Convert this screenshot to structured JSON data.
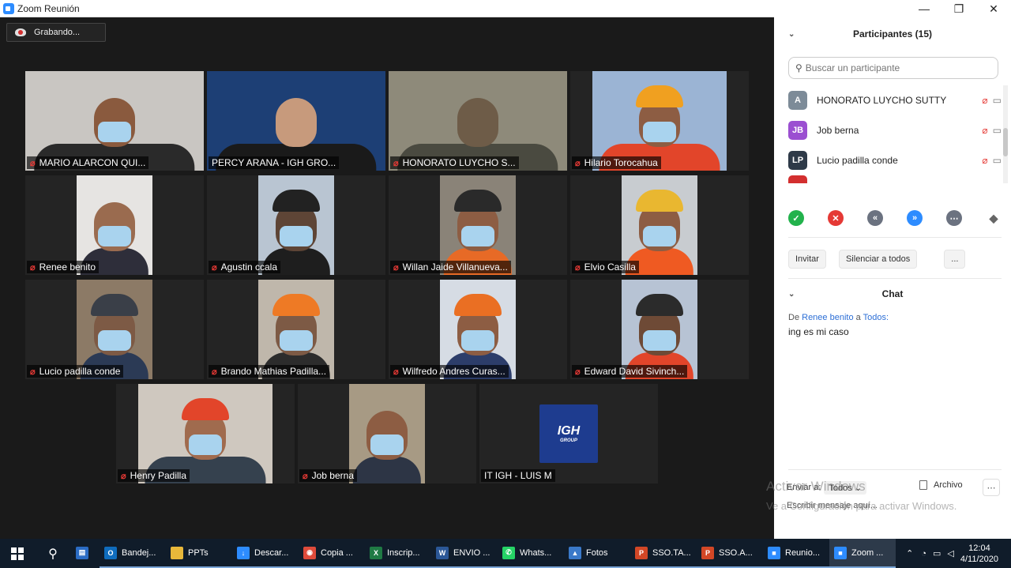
{
  "window": {
    "title": "Zoom Reunión",
    "controls": {
      "minimize": "—",
      "restore": "❐",
      "close": "✕"
    }
  },
  "recording": {
    "label": "Grabando..."
  },
  "tiles": [
    {
      "name": "MARIO ALARCON QUI...",
      "bg": "#c9c6c2",
      "skin": "#8a5a3e",
      "helmet": "",
      "body": "#2a2a2a",
      "muted": true
    },
    {
      "name": "PERCY ARANA - IGH GRO...",
      "bg": "#1d3f75",
      "skin": "#c79a7c",
      "helmet": "",
      "body": "#1a1a1a",
      "muted": false,
      "active": true
    },
    {
      "name": "HONORATO LUYCHO S...",
      "bg": "#8e8a7a",
      "skin": "#6e5c48",
      "helmet": "",
      "body": "#4a4a40",
      "muted": true
    },
    {
      "name": "Hilario Torocahua",
      "bg": "#9bb4d4",
      "skin": "#8d5d43",
      "helmet": "#f0a020",
      "body": "#e2452a",
      "muted": true
    },
    {
      "name": "Renee benito",
      "bg": "#e6e4e2",
      "skin": "#9a6b4f",
      "helmet": "",
      "body": "#2e2e3a",
      "muted": true
    },
    {
      "name": "Agustin ccala",
      "bg": "#b9c5d2",
      "skin": "#5e4536",
      "helmet": "#222222",
      "body": "#1e1e1e",
      "muted": true
    },
    {
      "name": "Willan Jaide Villanueva...",
      "bg": "#8a8378",
      "skin": "#8d5d43",
      "helmet": "#2a2a2a",
      "body": "#e76a26",
      "muted": true
    },
    {
      "name": "Elvio Casilla",
      "bg": "#c8ccd0",
      "skin": "#8d5d43",
      "helmet": "#e9b730",
      "body": "#ef5a22",
      "muted": true
    },
    {
      "name": "Lucio padilla conde",
      "bg": "#8c7a66",
      "skin": "#7d5a45",
      "helmet": "#3a3f48",
      "body": "#2b3a55",
      "muted": true
    },
    {
      "name": "Brando Mathias Padilla...",
      "bg": "#bfb7ab",
      "skin": "#7d5a45",
      "helmet": "#ee7a25",
      "body": "#2c2c2c",
      "muted": true
    },
    {
      "name": "Wilfredo Andres Curas...",
      "bg": "#d6dce4",
      "skin": "#8d5d43",
      "helmet": "#ea6f23",
      "body": "#2c3d6a",
      "muted": true
    },
    {
      "name": "Edward  David Sivinch...",
      "bg": "#b7c3d4",
      "skin": "#6e4a36",
      "helmet": "#2b2b2b",
      "body": "#e2452a",
      "muted": true
    },
    {
      "name": "Henry Padilla",
      "bg": "#cfc8bf",
      "skin": "#a06b4e",
      "helmet": "#e2452a",
      "body": "#35414e",
      "muted": true
    },
    {
      "name": "Job berna",
      "bg": "#a79a84",
      "skin": "#8d5d43",
      "helmet": "",
      "body": "#2d3545",
      "muted": true
    },
    {
      "name": "IT IGH - LUIS M",
      "bg": "#242424",
      "logo": "IGH",
      "logo_sub": "GROUP",
      "muted": false
    }
  ],
  "panel": {
    "participants_title": "Participantes (15)",
    "search_placeholder": "Buscar un participante",
    "participants": [
      {
        "initials": "A",
        "name": "HONORATO LUYCHO SUTTY",
        "color": "#7d8b98"
      },
      {
        "initials": "JB",
        "name": "Job berna",
        "color": "#9b4fd1"
      },
      {
        "initials": "LP",
        "name": "Lucio padilla conde",
        "color": "#2e3a48"
      }
    ],
    "actions": {
      "invite": "Invitar",
      "mute_all": "Silenciar a todos",
      "more": "..."
    },
    "chat_title": "Chat",
    "chat": {
      "from_prefix": "De",
      "sender": "Renee benito",
      "to_word": "a",
      "recipient": "Todos:",
      "message": "ing es mi caso"
    },
    "send_to_label": "Enviar a:",
    "send_to_value": "Todos",
    "file_label": "Archivo",
    "input_placeholder": "Escribir mensaje aquí...",
    "watermark_line1": "Activar Windows",
    "watermark_line2": "Ve a Configuración para activar Windows."
  },
  "taskbar": {
    "items": [
      {
        "label": "",
        "icon": "outlook-calendar-icon",
        "color": "#2b6cc4",
        "glyph": "▤"
      },
      {
        "label": "Bandej...",
        "icon": "outlook-icon",
        "color": "#0f6cbd",
        "glyph": "O"
      },
      {
        "label": "PPTs",
        "icon": "folder-icon",
        "color": "#e8b83a",
        "glyph": ""
      },
      {
        "label": "Descar...",
        "icon": "download-icon",
        "color": "#2d8cff",
        "glyph": "↓"
      },
      {
        "label": "Copia ...",
        "icon": "chrome-icon",
        "color": "#de4b3b",
        "glyph": "◉"
      },
      {
        "label": "Inscrip...",
        "icon": "excel-icon",
        "color": "#1f7a44",
        "glyph": "X"
      },
      {
        "label": "ENVIO ...",
        "icon": "word-icon",
        "color": "#2b5797",
        "glyph": "W"
      },
      {
        "label": "Whats...",
        "icon": "whatsapp-icon",
        "color": "#25d366",
        "glyph": "✆"
      },
      {
        "label": "Fotos",
        "icon": "photos-icon",
        "color": "#3a79c9",
        "glyph": "▲"
      },
      {
        "label": "SSO.TA...",
        "icon": "powerpoint-icon",
        "color": "#d24726",
        "glyph": "P"
      },
      {
        "label": "SSO.A...",
        "icon": "powerpoint-icon",
        "color": "#d24726",
        "glyph": "P"
      },
      {
        "label": "Reunio...",
        "icon": "zoom-icon",
        "color": "#2d8cff",
        "glyph": "■"
      },
      {
        "label": "Zoom ...",
        "icon": "zoom-icon",
        "color": "#2d8cff",
        "glyph": "■",
        "active": true
      }
    ],
    "time": "12:04",
    "date": "4/11/2020"
  }
}
